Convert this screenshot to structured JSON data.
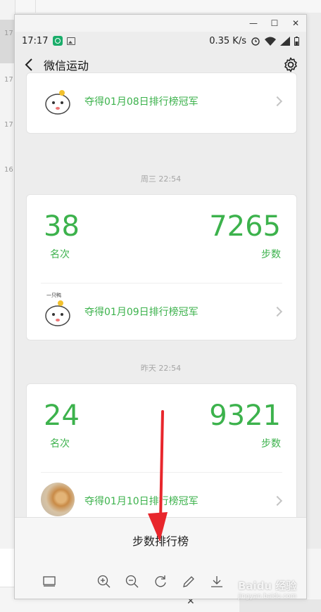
{
  "background": {
    "times": [
      "17",
      "17",
      "17",
      "16"
    ],
    "close_glyph": "✕"
  },
  "window": {
    "controls": [
      "—",
      "☐",
      "✕"
    ]
  },
  "status_bar": {
    "time": "17:17",
    "speed": "0.35 K/s"
  },
  "nav": {
    "title": "微信运动"
  },
  "feed": {
    "entries": [
      {
        "champion_text": "夺得01月08日排行榜冠军",
        "avatar": "cartoon"
      },
      {
        "time": "周三 22:54",
        "rank": "38",
        "rank_label": "名次",
        "steps": "7265",
        "steps_label": "步数",
        "champion_text": "夺得01月09日排行榜冠军",
        "avatar_caption": "一只鸭",
        "avatar": "cartoon"
      },
      {
        "time": "昨天 22:54",
        "rank": "24",
        "rank_label": "名次",
        "steps": "9321",
        "steps_label": "步数",
        "champion_text": "夺得01月10日排行榜冠军",
        "avatar": "cat-photo"
      }
    ]
  },
  "toolbar": {
    "title": "步数排行榜",
    "tools": [
      "layout-icon",
      "zoom-in-icon",
      "zoom-out-icon",
      "rotate-icon",
      "edit-icon",
      "download-icon"
    ]
  },
  "watermark": {
    "brand": "Baidu 经验",
    "sub": "jingyan.baidu.com"
  },
  "colors": {
    "accent": "#3cb24c",
    "arrow": "#e8262c"
  }
}
